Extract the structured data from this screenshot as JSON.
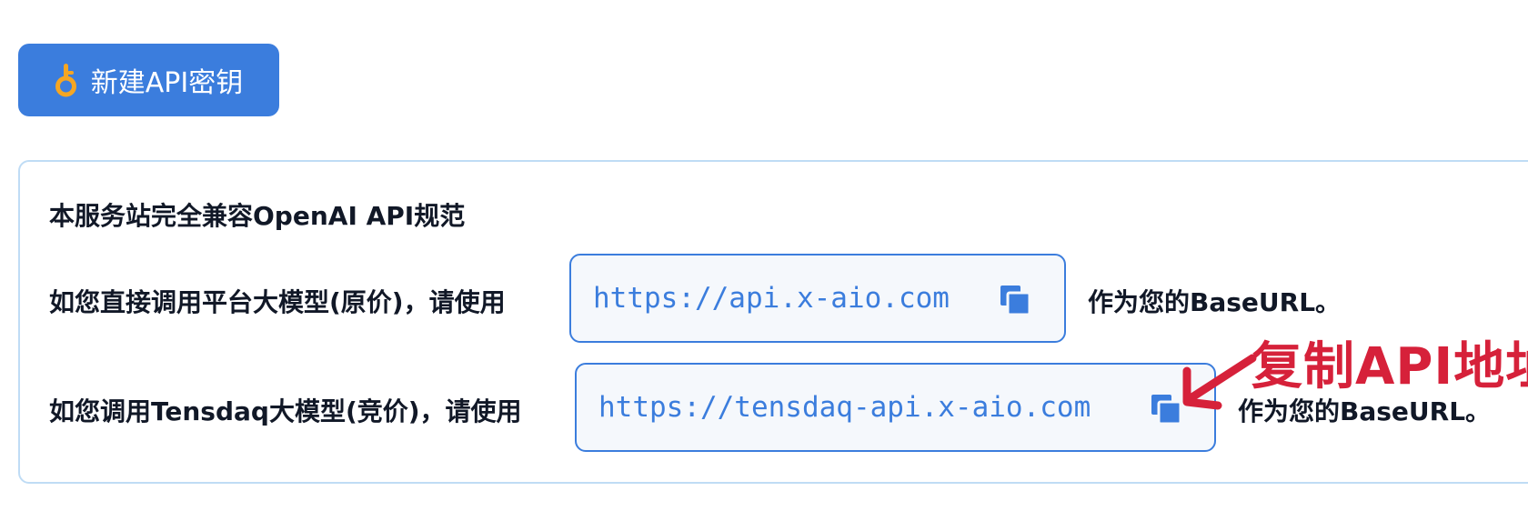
{
  "toolbar": {
    "new_key_label": "新建API密钥",
    "key_icon": "key-icon",
    "accent_color": "#3b7ddd",
    "icon_color": "#f5a623"
  },
  "info": {
    "intro": "本服务站完全兼容OpenAI API规范",
    "rows": [
      {
        "prefix": "如您直接调用平台大模型(原价)，请使用",
        "url": "https://api.x-aio.com",
        "suffix": "作为您的BaseURL。",
        "copy_icon": "copy-icon"
      },
      {
        "prefix": "如您调用Tensdaq大模型(竞价)，请使用",
        "url": "https://tensdaq-api.x-aio.com",
        "suffix": "作为您的BaseURL。",
        "copy_icon": "copy-icon"
      }
    ]
  },
  "annotation": {
    "text": "复制API地址",
    "color": "#d6213a"
  }
}
